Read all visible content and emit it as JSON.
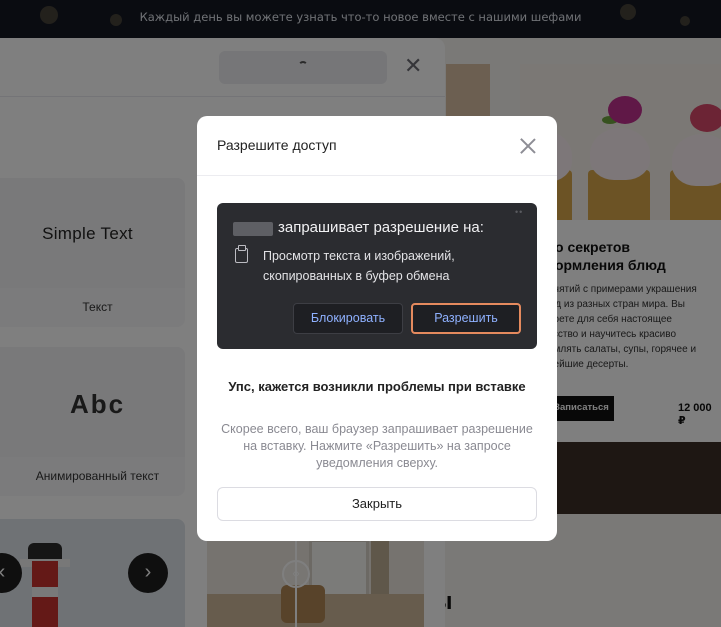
{
  "site": {
    "banner_text": "Каждый день вы можете узнать что-то новое вместе с нашими шефами",
    "card": {
      "title": "о секретов\nормления блюд",
      "description": "анятий с примерами украшения\nюд из разных стран мира. Вы\nроете для себя настоящее\nусство и научитесь красиво\nрмлять салаты, супы, горячее и\nнейшие десерты.",
      "button_label": "Записаться",
      "price": "12 000 ₽"
    },
    "bottom_heading": "ы"
  },
  "editor": {
    "tiles": [
      {
        "preview_text": "Simple Text",
        "caption": "Текст"
      },
      {
        "preview_text": "Abc",
        "caption": "Анимированный текст"
      }
    ],
    "carousel": {
      "prev_icon": "‹",
      "next_icon": "›"
    },
    "compare_handle_icon": "‹›",
    "close_icon": "✕"
  },
  "modal": {
    "title": "Разрешите доступ",
    "permission": {
      "heading": "запрашивает разрешение на:",
      "line1": "Просмотр текста и изображений,",
      "line2": "скопированных в буфер обмена",
      "block_label": "Блокировать",
      "allow_label": "Разрешить"
    },
    "error_title": "Упс, кажется возникли проблемы при вставке",
    "error_description": "Скорее всего, ваш браузер запрашивает разрешение на вставку. Нажмите «Разрешить» на запросе уведомления сверху.",
    "close_label": "Закрыть"
  },
  "colors": {
    "overlay": "rgba(0,0,0,0.5)",
    "permission_card": "#2b2c30",
    "allow_border": "#e58a5e",
    "permission_button_text": "#8fb1ff"
  }
}
